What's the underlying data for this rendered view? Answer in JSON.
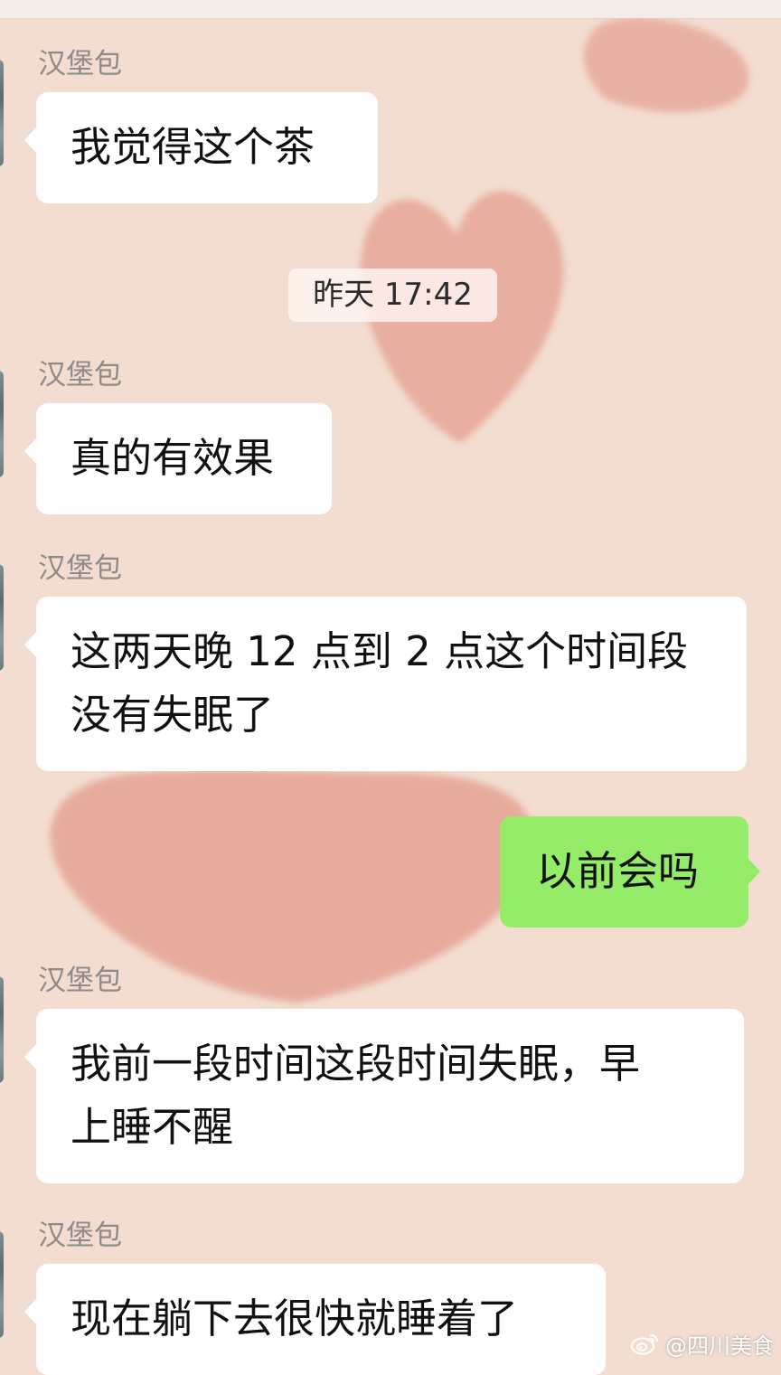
{
  "chat": {
    "messages": [
      {
        "sender": "汉堡包",
        "text": "我觉得这个茶"
      },
      {
        "sender": "汉堡包",
        "text": "真的有效果"
      },
      {
        "sender": "汉堡包",
        "text": "这两天晚 12 点到 2 点这个时间段\n没有失眠了"
      },
      {
        "text": "以前会吗"
      },
      {
        "sender": "汉堡包",
        "text": "我前一段时间这段时间失眠，早\n上睡不醒"
      },
      {
        "sender": "汉堡包",
        "text": "现在躺下去很快就睡着了"
      }
    ],
    "timestamp": "昨天 17:42"
  },
  "watermark": {
    "text": "@四川美食",
    "icon": "weibo-icon"
  },
  "colors": {
    "background": "#f2ddd0",
    "heart": "#e6a394",
    "incoming_bubble": "#ffffff",
    "outgoing_bubble": "#95ec69"
  }
}
